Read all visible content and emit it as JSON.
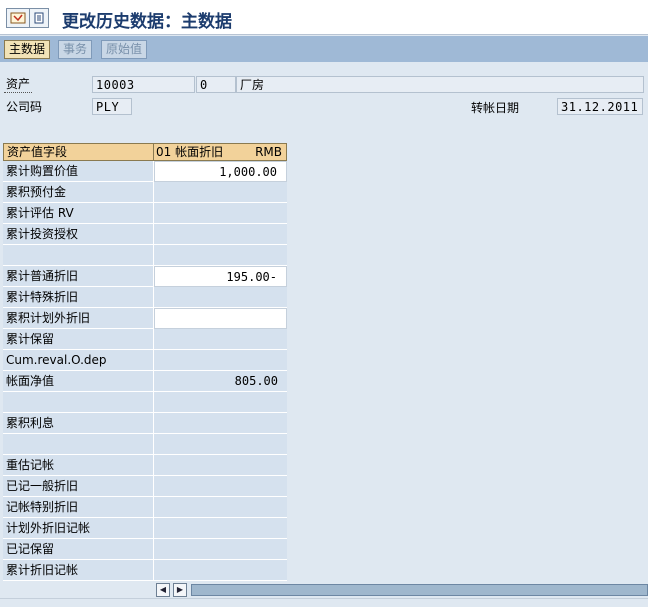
{
  "title": "更改历史数据：主数据",
  "tabs": [
    {
      "label": "主数据",
      "active": true
    },
    {
      "label": "事务",
      "active": false
    },
    {
      "label": "原始值",
      "active": false
    }
  ],
  "header": {
    "asset_label": "资产",
    "asset_number": "10003",
    "sub_number": "0",
    "asset_description": "厂房",
    "company_code_label": "公司码",
    "company_code": "PLY",
    "posting_date_label": "转帐日期",
    "posting_date": "31.12.2011"
  },
  "table": {
    "col1_header": "资产值字段",
    "col2_header": "01 帐面折旧",
    "col2_currency": "RMB",
    "rows": [
      {
        "label": "累计购置价值",
        "value": "1,000.00",
        "input": true
      },
      {
        "label": "累积预付金",
        "value": "",
        "input": false
      },
      {
        "label": "累计评估  RV",
        "value": "",
        "input": false
      },
      {
        "label": "累计投资授权",
        "value": "",
        "input": false
      },
      {
        "label": "",
        "value": "",
        "input": false
      },
      {
        "label": "累计普通折旧",
        "value": "195.00-",
        "input": true
      },
      {
        "label": "累计特殊折旧",
        "value": "",
        "input": false
      },
      {
        "label": "累积计划外折旧",
        "value": "",
        "input": true
      },
      {
        "label": "累计保留",
        "value": "",
        "input": false
      },
      {
        "label": "Cum.reval.O.dep",
        "value": "",
        "input": false
      },
      {
        "label": "帐面净值",
        "value": "805.00",
        "input": false
      },
      {
        "label": "",
        "value": "",
        "input": false
      },
      {
        "label": "累积利息",
        "value": "",
        "input": false
      },
      {
        "label": "",
        "value": "",
        "input": false
      },
      {
        "label": "重估记帐",
        "value": "",
        "input": false
      },
      {
        "label": "已记一般折旧",
        "value": "",
        "input": false
      },
      {
        "label": "记帐特别折旧",
        "value": "",
        "input": false
      },
      {
        "label": "计划外折旧记帐",
        "value": "",
        "input": false
      },
      {
        "label": "已记保留",
        "value": "",
        "input": false
      },
      {
        "label": "累计折旧记帐",
        "value": "",
        "input": false
      }
    ]
  },
  "icons": {
    "toolbar_1": "display-change-icon",
    "toolbar_2": "document-icon",
    "scroll_left": "arrow-left-icon",
    "scroll_right": "arrow-right-icon"
  },
  "colors": {
    "title": "#1c3c6e",
    "tabbar": "#9fb9d6",
    "header_row": "#f2d29a",
    "cell": "#d5e1ee"
  }
}
